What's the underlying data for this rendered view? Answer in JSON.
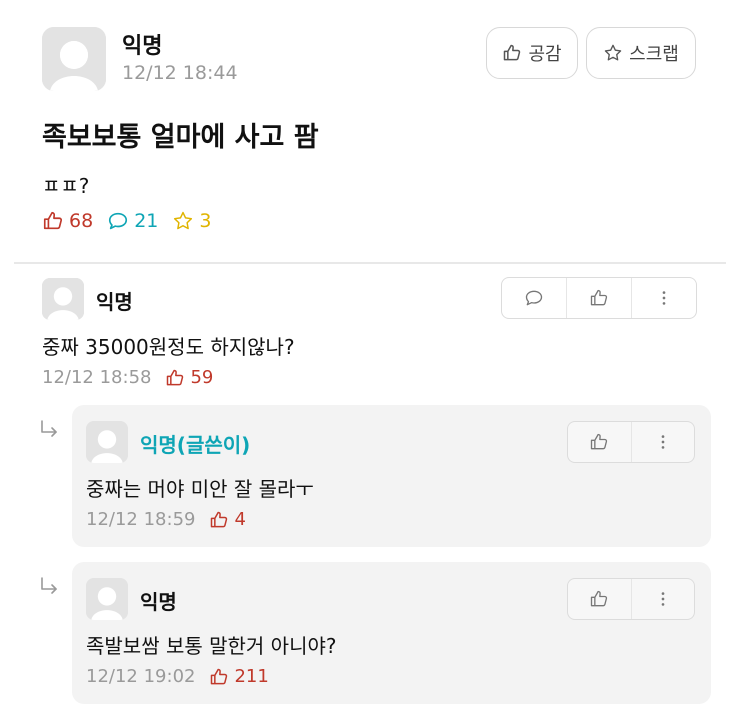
{
  "post": {
    "author": "익명",
    "time": "12/12 18:44",
    "like_button": "공감",
    "scrap_button": "스크랩",
    "title": "족보보통 얼마에 사고 팜",
    "body": "ㅍㅍ?",
    "stats": {
      "likes": "68",
      "comments": "21",
      "scraps": "3"
    }
  },
  "comments": [
    {
      "author": "익명",
      "text": "중짜 35000원정도 하지않나?",
      "time": "12/12 18:58",
      "likes": "59",
      "replies": [
        {
          "author": "익명(글쓴이)",
          "is_writer": true,
          "text": "중짜는 머야 미안 잘 몰라ㅜ",
          "time": "12/12 18:59",
          "likes": "4"
        },
        {
          "author": "익명",
          "is_writer": false,
          "text": "족발보쌈 보통 말한거 아니야?",
          "time": "12/12 19:02",
          "likes": "211"
        }
      ]
    }
  ],
  "colors": {
    "like": "#c0392b",
    "comment": "#0ea5b5",
    "scrap": "#e0b400",
    "writer": "#0ea5b5"
  },
  "icons": [
    "thumbs-up-icon",
    "star-icon",
    "speech-bubble-icon",
    "more-vertical-icon",
    "reply-arrow-icon",
    "default-avatar-icon"
  ]
}
